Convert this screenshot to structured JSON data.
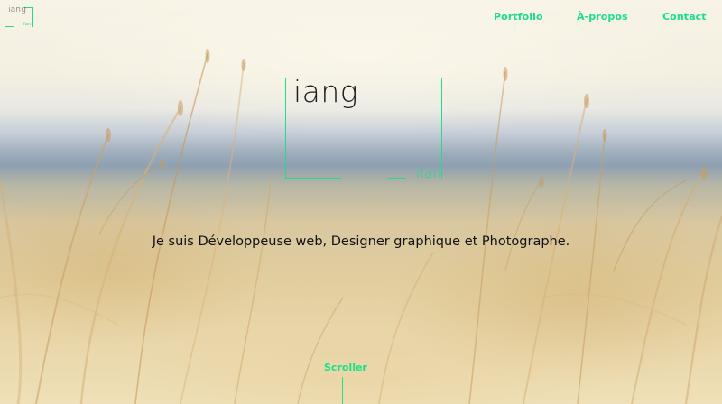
{
  "header": {
    "logo": {
      "top_text": "iang",
      "bottom_text": "ifan"
    },
    "nav": [
      {
        "label": "Portfolio"
      },
      {
        "label": "À-propos"
      },
      {
        "label": "Contact"
      }
    ]
  },
  "hero": {
    "brand": {
      "top_text": "iang",
      "bottom_text": "ifan"
    },
    "tagline": "Je suis Développeuse web, Designer graphique et Photographe.",
    "scroll_label": "Scroller"
  },
  "colors": {
    "accent": "#22dd88",
    "text": "#111111"
  }
}
